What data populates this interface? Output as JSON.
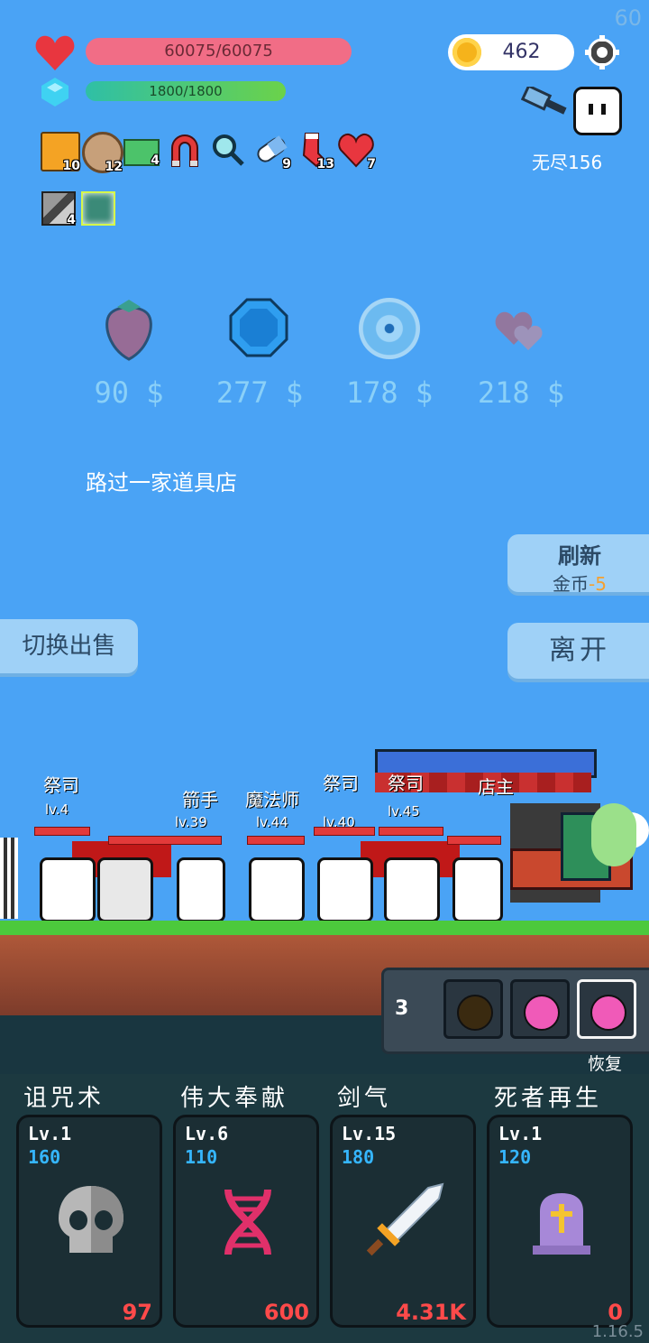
{
  "fps": "60",
  "hp": {
    "text": "60075/60075",
    "fraction": 1.0
  },
  "mp": {
    "text": "1800/1800",
    "fraction": 1.0
  },
  "coins": "462",
  "endless": "无尽156",
  "items_row1": [
    {
      "icon": "book-icon",
      "count": "10"
    },
    {
      "icon": "shield-disk-icon",
      "count": "12"
    },
    {
      "icon": "money-heart-icon",
      "count": "4"
    },
    {
      "icon": "magnet-icon",
      "count": ""
    },
    {
      "icon": "magnifier-icon",
      "count": ""
    },
    {
      "icon": "pill-icon",
      "count": "9"
    },
    {
      "icon": "sock-icon",
      "count": "13"
    },
    {
      "icon": "heart-item-icon",
      "count": "7"
    }
  ],
  "items_row2": [
    {
      "icon": "blade-card-icon",
      "count": "4"
    },
    {
      "icon": "light-card-icon",
      "count": ""
    }
  ],
  "shop": [
    {
      "icon": "strawberry-icon",
      "price": "90 $"
    },
    {
      "icon": "blue-gem-icon",
      "price": "277 $"
    },
    {
      "icon": "blue-orb-icon",
      "price": "178 $"
    },
    {
      "icon": "double-heart-icon",
      "price": "218 $"
    }
  ],
  "event_text": "路过一家道具店",
  "refresh": {
    "title": "刷新",
    "cost_label": "金币",
    "cost_value": "-5"
  },
  "leave": "离开",
  "swap_sell": "切换出售",
  "potions": {
    "count": "3",
    "label": "恢复"
  },
  "units": [
    {
      "name": "祭司",
      "lv": "lv.4"
    },
    {
      "name": "箭手",
      "lv": "lv.39"
    },
    {
      "name": "魔法师",
      "lv": "lv.44"
    },
    {
      "name": "祭司",
      "lv": "lv.40"
    },
    {
      "name": "祭司",
      "lv": "lv.45"
    },
    {
      "name": "店主",
      "lv": ""
    }
  ],
  "skills": [
    {
      "name": "诅咒术",
      "lv": "Lv.1",
      "cost": "160",
      "value": "97",
      "icon": "skull-icon"
    },
    {
      "name": "伟大奉献",
      "lv": "Lv.6",
      "cost": "110",
      "value": "600",
      "icon": "dna-icon"
    },
    {
      "name": "剑气",
      "lv": "Lv.15",
      "cost": "180",
      "value": "4.31K",
      "icon": "sword-icon"
    },
    {
      "name": "死者再生",
      "lv": "Lv.1",
      "cost": "120",
      "value": "0",
      "icon": "tombstone-icon"
    }
  ],
  "version": "1.16.5",
  "colors": {
    "sky": "#4aa3f5",
    "hp": "#f16d86",
    "mp": "#4fc86e",
    "grass": "#4cc93c",
    "panel": "#1c3940"
  }
}
